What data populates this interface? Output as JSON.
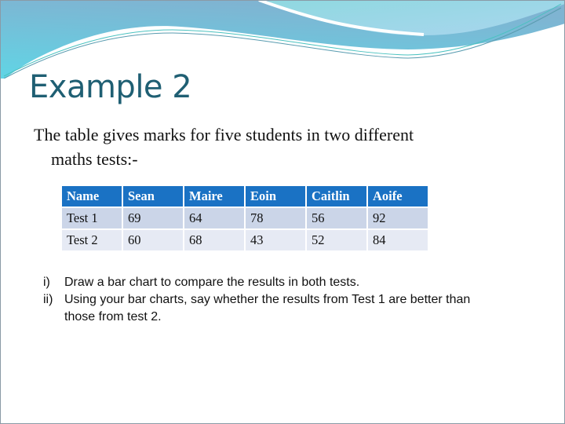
{
  "slide": {
    "title": "Example 2",
    "intro_line1": "The table gives marks for five students in two different",
    "intro_line2": "maths tests:-",
    "table": {
      "header": [
        "Name",
        "Sean",
        "Maire",
        "Eoin",
        "Caitlin",
        "Aoife"
      ],
      "rows": [
        [
          "Test 1",
          "69",
          "64",
          "78",
          "56",
          "92"
        ],
        [
          "Test 2",
          "60",
          "68",
          "43",
          "52",
          "84"
        ]
      ]
    },
    "questions": [
      {
        "num": "i)",
        "text": "Draw a bar chart to compare the results in both tests."
      },
      {
        "num": "ii)",
        "text": "Using your bar charts, say whether the results from Test 1 are better than",
        "cont": "those from test 2."
      }
    ]
  },
  "colors": {
    "title": "#1f5f73",
    "header_bg": "#1a72c4",
    "row1_bg": "#cbd5e8",
    "row2_bg": "#e6eaf4",
    "wave": "#6fc6dc"
  }
}
